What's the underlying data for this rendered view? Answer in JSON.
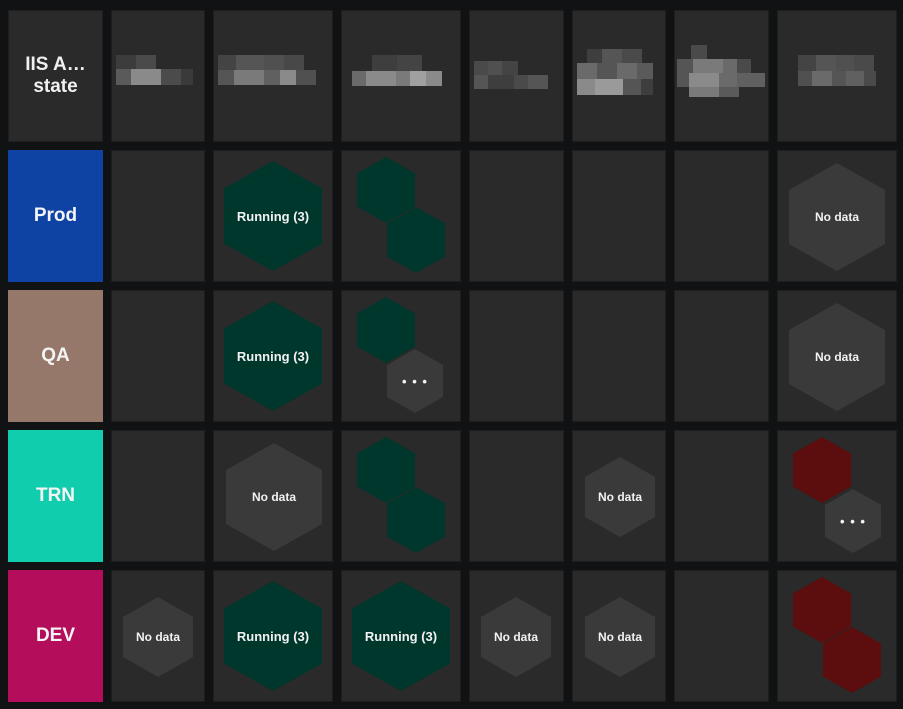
{
  "corner": {
    "line1": "IIS A…",
    "line2": "state"
  },
  "colors": {
    "running": "#00372d",
    "nodata": "#3a3a3a",
    "error": "#5c0d0d",
    "cell_bg": "#2a2a2a"
  },
  "environments": [
    {
      "label": "Prod",
      "color": "#0e43a3"
    },
    {
      "label": "QA",
      "color": "#957869"
    },
    {
      "label": "TRN",
      "color": "#10cdae"
    },
    {
      "label": "DEV",
      "color": "#b40d5c"
    }
  ],
  "statuses": {
    "running": "Running (3)",
    "nodata": "No data",
    "more": "• • •"
  },
  "columns_count": 7
}
